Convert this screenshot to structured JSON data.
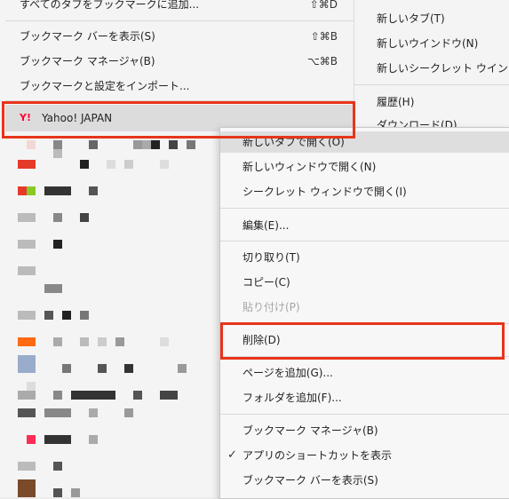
{
  "bookmarks_menu": {
    "items": [
      {
        "label": "すべてのタブをブックマークに追加...",
        "shortcut": "⇧⌘D"
      },
      {
        "label": "ブックマーク バーを表示(S)",
        "shortcut": "⇧⌘B"
      },
      {
        "label": "ブックマーク マネージャ(B)",
        "shortcut": "⌥⌘B"
      },
      {
        "label": "ブックマークと設定をインポート..."
      }
    ],
    "yahoo": {
      "logo": "Y!",
      "label": "Yahoo! JAPAN"
    }
  },
  "main_menu": {
    "items": [
      {
        "label": "新しいタブ(T)"
      },
      {
        "label": "新しいウインドウ(N)"
      },
      {
        "label": "新しいシークレット ウイン"
      },
      {
        "label": "履歴(H)"
      },
      {
        "label": "ダウンロード(D)"
      }
    ]
  },
  "context_menu": {
    "items": [
      {
        "label": "新しいタブで開く(O)"
      },
      {
        "label": "新しいウィンドウで開く(N)"
      },
      {
        "label": "シークレット ウィンドウで開く(I)"
      },
      {
        "label": "編集(E)..."
      },
      {
        "label": "切り取り(T)"
      },
      {
        "label": "コピー(C)"
      },
      {
        "label": "貼り付け(P)"
      },
      {
        "label": "削除(D)"
      },
      {
        "label": "ページを追加(G)..."
      },
      {
        "label": "フォルダを追加(F)..."
      },
      {
        "label": "ブックマーク マネージャ(B)"
      },
      {
        "label": "アプリのショートカットを表示",
        "checked": "✓"
      },
      {
        "label": "ブックマーク バーを表示(S)"
      }
    ]
  },
  "colors": {
    "highlight_border": "#e8341c",
    "menu_bg": "#f4f4f4",
    "selected_row_bg": "#dcdcdc"
  }
}
